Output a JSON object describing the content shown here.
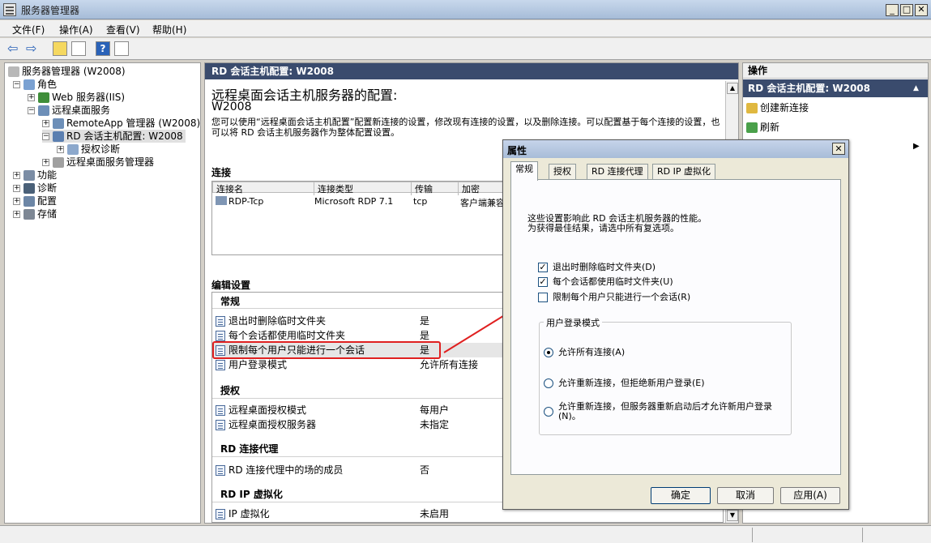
{
  "window": {
    "title": "服务器管理器"
  },
  "menu": [
    "文件(F)",
    "操作(A)",
    "查看(V)",
    "帮助(H)"
  ],
  "tree": {
    "root": "服务器管理器 (W2008)",
    "roles": "角色",
    "web_server": "Web 服务器(IIS)",
    "rds": "远程桌面服务",
    "remoteapp": "RemoteApp 管理器 (W2008)",
    "rdsh_config": "RD 会话主机配置: W2008",
    "licensing_diag": "授权诊断",
    "rd_manager": "远程桌面服务管理器",
    "features": "功能",
    "diagnostics": "诊断",
    "configuration": "配置",
    "storage": "存储"
  },
  "main": {
    "header": "RD 会话主机配置: W2008",
    "title": "远程桌面会话主机服务器的配置:",
    "server": "W2008",
    "description": "您可以使用“远程桌面会话主机配置”配置新连接的设置，修改现有连接的设置，以及删除连接。可以配置基于每个连接的设置，也可以将 RD 会话主机服务器作为整体配置设置。",
    "connections_title": "连接",
    "columns": [
      "连接名",
      "连接类型",
      "传输",
      "加密"
    ],
    "connection_row": [
      "RDP-Tcp",
      "Microsoft RDP 7.1",
      "tcp",
      "客户端兼容"
    ],
    "edit_title": "编辑设置",
    "groups": [
      {
        "name": "常规",
        "rows": [
          {
            "label": "退出时删除临时文件夹",
            "value": "是"
          },
          {
            "label": "每个会话都使用临时文件夹",
            "value": "是"
          },
          {
            "label": "限制每个用户只能进行一个会话",
            "value": "是"
          },
          {
            "label": "用户登录模式",
            "value": "允许所有连接"
          }
        ]
      },
      {
        "name": "授权",
        "rows": [
          {
            "label": "远程桌面授权模式",
            "value": "每用户"
          },
          {
            "label": "远程桌面授权服务器",
            "value": "未指定"
          }
        ]
      },
      {
        "name": "RD 连接代理",
        "rows": [
          {
            "label": "RD 连接代理中的场的成员",
            "value": "否"
          }
        ]
      },
      {
        "name": "RD IP 虚拟化",
        "rows": [
          {
            "label": "IP 虚拟化",
            "value": "未启用"
          }
        ]
      }
    ]
  },
  "actions": {
    "title": "操作",
    "section": "RD 会话主机配置: W2008",
    "items": [
      "创建新连接",
      "刷新"
    ]
  },
  "dialog": {
    "title": "属性",
    "tabs": [
      "常规",
      "授权",
      "RD 连接代理",
      "RD IP 虚拟化"
    ],
    "desc1": "这些设置影响此 RD 会话主机服务器的性能。",
    "desc2": "为获得最佳结果，请选中所有复选项。",
    "checkboxes": [
      {
        "label": "退出时删除临时文件夹(D)",
        "checked": true
      },
      {
        "label": "每个会话都使用临时文件夹(U)",
        "checked": true
      },
      {
        "label": "限制每个用户只能进行一个会话(R)",
        "checked": false
      }
    ],
    "group_title": "用户登录模式",
    "radios": [
      {
        "label": "允许所有连接(A)",
        "selected": true
      },
      {
        "label": "允许重新连接，但拒绝新用户登录(E)",
        "selected": false
      },
      {
        "label": "允许重新连接，但服务器重新启动后才允许新用户登录(N)。",
        "selected": false
      }
    ],
    "ok": "确定",
    "cancel": "取消",
    "apply": "应用(A)"
  },
  "colors": {
    "highlight": "#e02020",
    "arrow": "#e02020",
    "header_bg": "#3a4b6d"
  }
}
